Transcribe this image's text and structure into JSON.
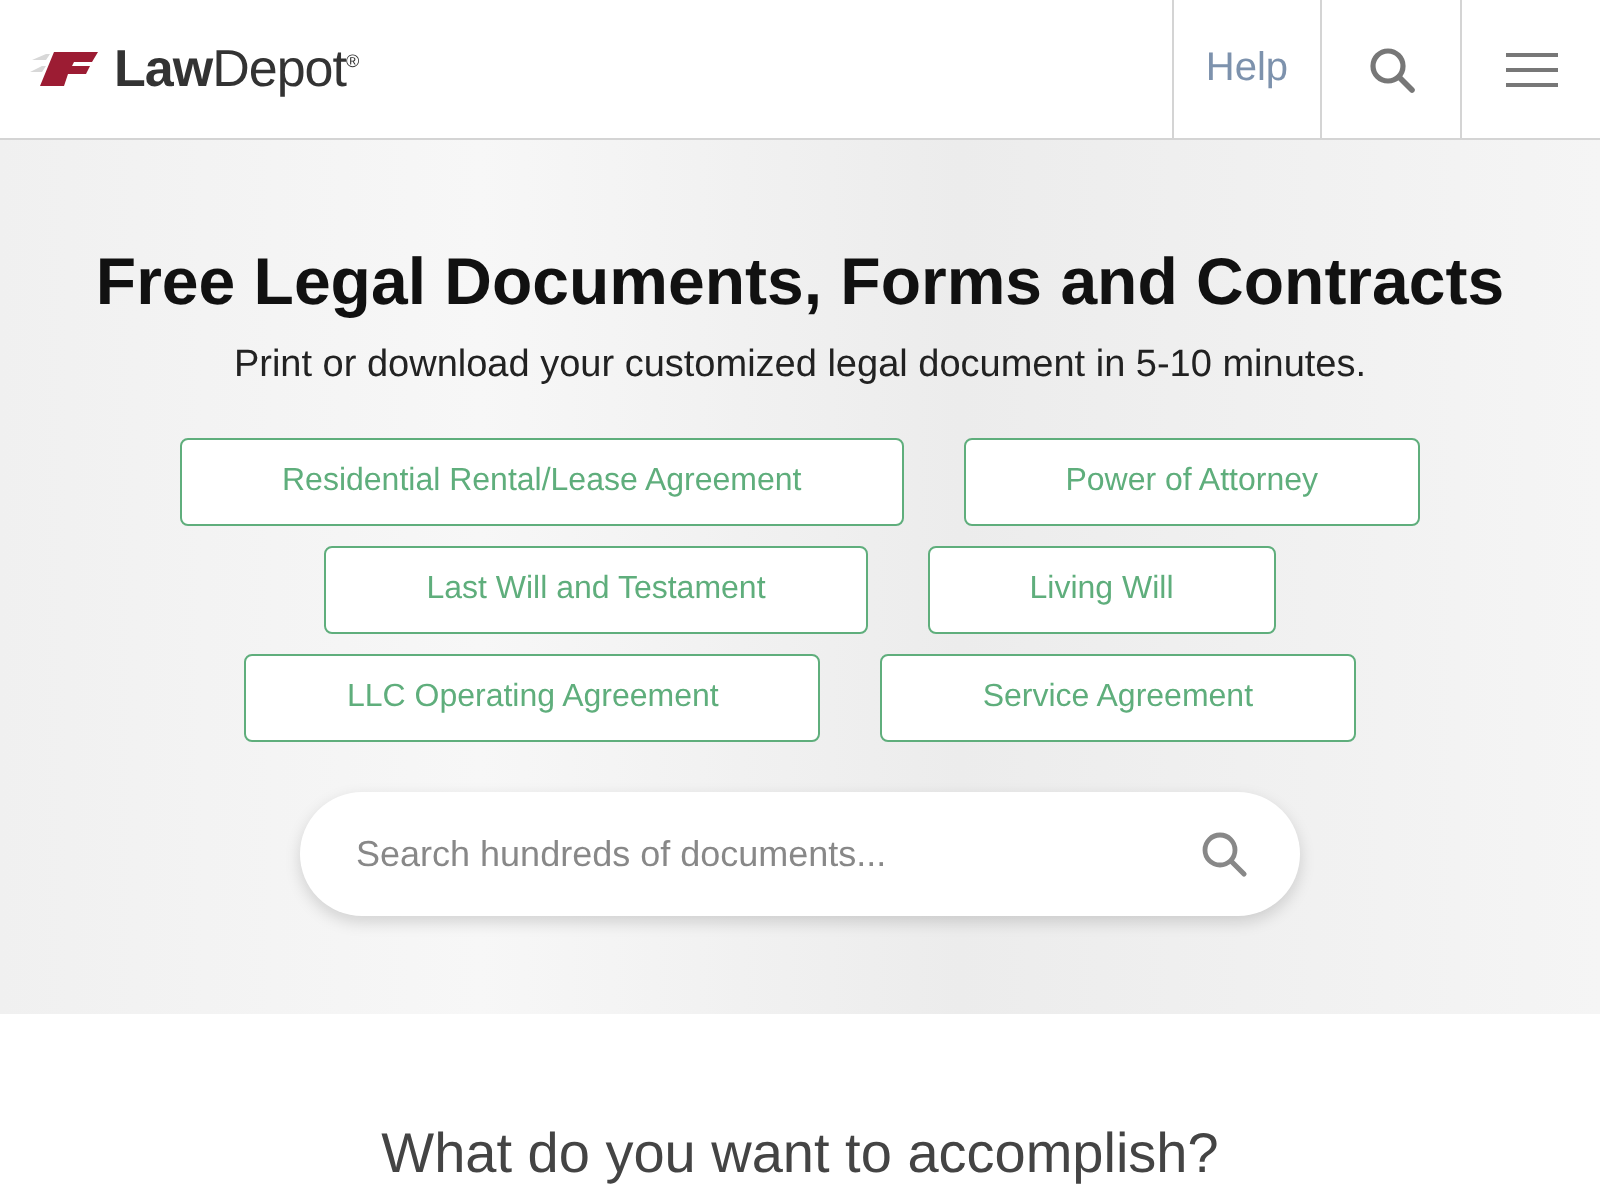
{
  "header": {
    "logo": "**Law**Depot$^{®}$",
    "nav": [
      "Help"
    ]
  },
  "hero": {
    "title": "Free Legal Documents, Forms and Contracts",
    "subtitle": "Print or download your customized legal document in 5-10 minutes.",
    "document_links": [
      [
        "Residential Rental/Lease Agreement",
        "Power of Attorney"
      ],
      [
        "Last Will and Testament",
        "Living Will"
      ],
      [
        "LLC Operating Agreement",
        "Service Agreement"
      ]
    ],
    "search": {
      "placeholder": "Search hundreds of documents..."
    }
  },
  "section": {
    "heading": "What do you want to accomplish?"
  }
}
